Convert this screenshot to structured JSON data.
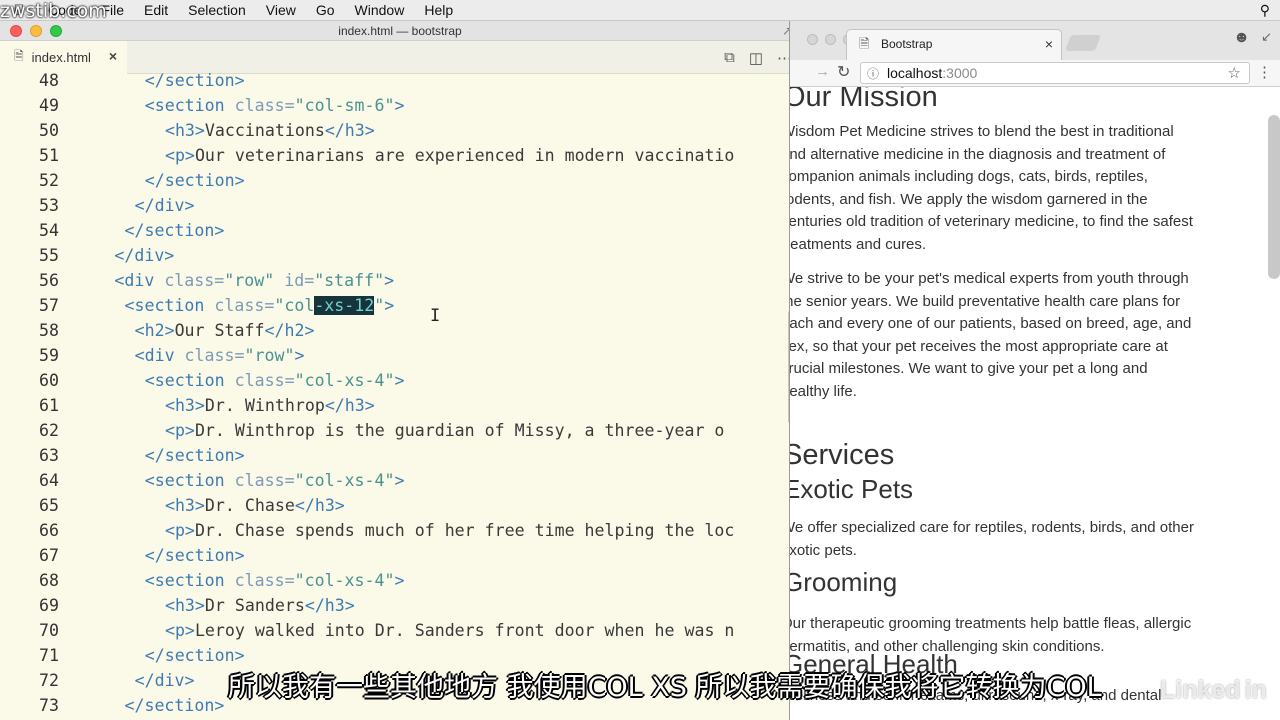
{
  "watermark": "zwstib.com",
  "menubar": {
    "items": [
      "Code",
      "File",
      "Edit",
      "Selection",
      "View",
      "Go",
      "Window",
      "Help"
    ]
  },
  "editor": {
    "window_title": "index.html — bootstrap",
    "tab_label": "index.html",
    "lines": [
      {
        "n": 48,
        "indent": 6,
        "parts": [
          [
            "tag",
            "</section>"
          ]
        ]
      },
      {
        "n": 49,
        "indent": 6,
        "parts": [
          [
            "tag",
            "<section "
          ],
          [
            "attr",
            "class="
          ],
          [
            "str",
            "\"col-sm-6\""
          ],
          [
            "tag",
            ">"
          ]
        ]
      },
      {
        "n": 50,
        "indent": 8,
        "parts": [
          [
            "tag",
            "<h3>"
          ],
          [
            "txt",
            "Vaccinations"
          ],
          [
            "tag",
            "</h3>"
          ]
        ]
      },
      {
        "n": 51,
        "indent": 8,
        "parts": [
          [
            "tag",
            "<p>"
          ],
          [
            "txt",
            "Our veterinarians are experienced in modern vaccinatio"
          ]
        ]
      },
      {
        "n": 52,
        "indent": 6,
        "parts": [
          [
            "tag",
            "</section>"
          ]
        ]
      },
      {
        "n": 53,
        "indent": 5,
        "parts": [
          [
            "tag",
            "</div>"
          ]
        ]
      },
      {
        "n": 54,
        "indent": 4,
        "parts": [
          [
            "tag",
            "</section>"
          ]
        ]
      },
      {
        "n": 55,
        "indent": 3,
        "parts": [
          [
            "tag",
            "</div>"
          ]
        ]
      },
      {
        "n": 56,
        "indent": 3,
        "parts": [
          [
            "tag",
            "<div "
          ],
          [
            "attr",
            "class="
          ],
          [
            "str",
            "\"row\""
          ],
          [
            "attr",
            " id="
          ],
          [
            "str",
            "\"staff\""
          ],
          [
            "tag",
            ">"
          ]
        ]
      },
      {
        "n": 57,
        "indent": 4,
        "parts": [
          [
            "tag",
            "<section "
          ],
          [
            "attr",
            "class="
          ],
          [
            "str",
            "\"col"
          ],
          [
            "sel",
            "-xs-12"
          ],
          [
            "str",
            "\""
          ],
          [
            "tag",
            ">"
          ]
        ]
      },
      {
        "n": 58,
        "indent": 5,
        "parts": [
          [
            "tag",
            "<h2>"
          ],
          [
            "txt",
            "Our Staff"
          ],
          [
            "tag",
            "</h2>"
          ]
        ]
      },
      {
        "n": 59,
        "indent": 5,
        "parts": [
          [
            "tag",
            "<div "
          ],
          [
            "attr",
            "class="
          ],
          [
            "str",
            "\"row\""
          ],
          [
            "tag",
            ">"
          ]
        ]
      },
      {
        "n": 60,
        "indent": 6,
        "parts": [
          [
            "tag",
            "<section "
          ],
          [
            "attr",
            "class="
          ],
          [
            "str",
            "\"col-xs-4\""
          ],
          [
            "tag",
            ">"
          ]
        ]
      },
      {
        "n": 61,
        "indent": 8,
        "parts": [
          [
            "tag",
            "<h3>"
          ],
          [
            "txt",
            "Dr. Winthrop"
          ],
          [
            "tag",
            "</h3>"
          ]
        ]
      },
      {
        "n": 62,
        "indent": 8,
        "parts": [
          [
            "tag",
            "<p>"
          ],
          [
            "txt",
            "Dr. Winthrop is the guardian of Missy, a three-year o"
          ]
        ]
      },
      {
        "n": 63,
        "indent": 6,
        "parts": [
          [
            "tag",
            "</section>"
          ]
        ]
      },
      {
        "n": 64,
        "indent": 6,
        "parts": [
          [
            "tag",
            "<section "
          ],
          [
            "attr",
            "class="
          ],
          [
            "str",
            "\"col-xs-4\""
          ],
          [
            "tag",
            ">"
          ]
        ]
      },
      {
        "n": 65,
        "indent": 8,
        "parts": [
          [
            "tag",
            "<h3>"
          ],
          [
            "txt",
            "Dr. Chase"
          ],
          [
            "tag",
            "</h3>"
          ]
        ]
      },
      {
        "n": 66,
        "indent": 8,
        "parts": [
          [
            "tag",
            "<p>"
          ],
          [
            "txt",
            "Dr. Chase spends much of her free time helping the loc"
          ]
        ]
      },
      {
        "n": 67,
        "indent": 6,
        "parts": [
          [
            "tag",
            "</section>"
          ]
        ]
      },
      {
        "n": 68,
        "indent": 6,
        "parts": [
          [
            "tag",
            "<section "
          ],
          [
            "attr",
            "class="
          ],
          [
            "str",
            "\"col-xs-4\""
          ],
          [
            "tag",
            ">"
          ]
        ]
      },
      {
        "n": 69,
        "indent": 8,
        "parts": [
          [
            "tag",
            "<h3>"
          ],
          [
            "txt",
            "Dr Sanders"
          ],
          [
            "tag",
            "</h3>"
          ]
        ]
      },
      {
        "n": 70,
        "indent": 8,
        "parts": [
          [
            "tag",
            "<p>"
          ],
          [
            "txt",
            "Leroy walked into Dr. Sanders front door when he was n"
          ]
        ]
      },
      {
        "n": 71,
        "indent": 6,
        "parts": [
          [
            "tag",
            "</section>"
          ]
        ]
      },
      {
        "n": 72,
        "indent": 5,
        "parts": [
          [
            "tag",
            "</div>"
          ]
        ]
      },
      {
        "n": 73,
        "indent": 4,
        "parts": [
          [
            "tag",
            "</section>"
          ]
        ]
      }
    ]
  },
  "browser": {
    "tab_title": "Bootstrap",
    "url_host": "localhost",
    "url_port": ":3000",
    "content": [
      {
        "kind": "h2",
        "text": "Our Mission"
      },
      {
        "kind": "p",
        "lines": [
          "Wisdom Pet Medicine strives to blend the best in traditional",
          "and alternative medicine in the diagnosis and treatment of",
          "companion animals including dogs, cats, birds, reptiles,",
          "rodents, and fish. We apply the wisdom garnered in the",
          "centuries old tradition of veterinary medicine, to find the safest",
          "treatments and cures."
        ]
      },
      {
        "kind": "p",
        "lines": [
          "We strive to be your pet's medical experts from youth through",
          "the senior years. We build preventative health care plans for",
          "each and every one of our patients, based on breed, age, and",
          "sex, so that your pet receives the most appropriate care at",
          "crucial milestones. We want to give your pet a long and",
          "healthy life."
        ]
      },
      {
        "kind": "h2",
        "text": "Services"
      },
      {
        "kind": "h3",
        "text": "Exotic Pets"
      },
      {
        "kind": "p",
        "lines": [
          "We offer specialized care for reptiles, rodents, birds, and other",
          "exotic pets."
        ]
      },
      {
        "kind": "h3",
        "text": "Grooming"
      },
      {
        "kind": "p",
        "lines": [
          "Our therapeutic grooming treatments help battle fleas, allergic",
          "dermatitis, and other challenging skin conditions."
        ]
      },
      {
        "kind": "h3",
        "text": "General Health"
      },
      {
        "kind": "p",
        "lines": [
          "Wellness and senior exams, ultrasound, x-ray, and dental"
        ]
      }
    ]
  },
  "subtitle": "所以我有一些其他地方 我使用COL XS 所以我需要确保我将它转换为COL",
  "logo": "Linked in"
}
